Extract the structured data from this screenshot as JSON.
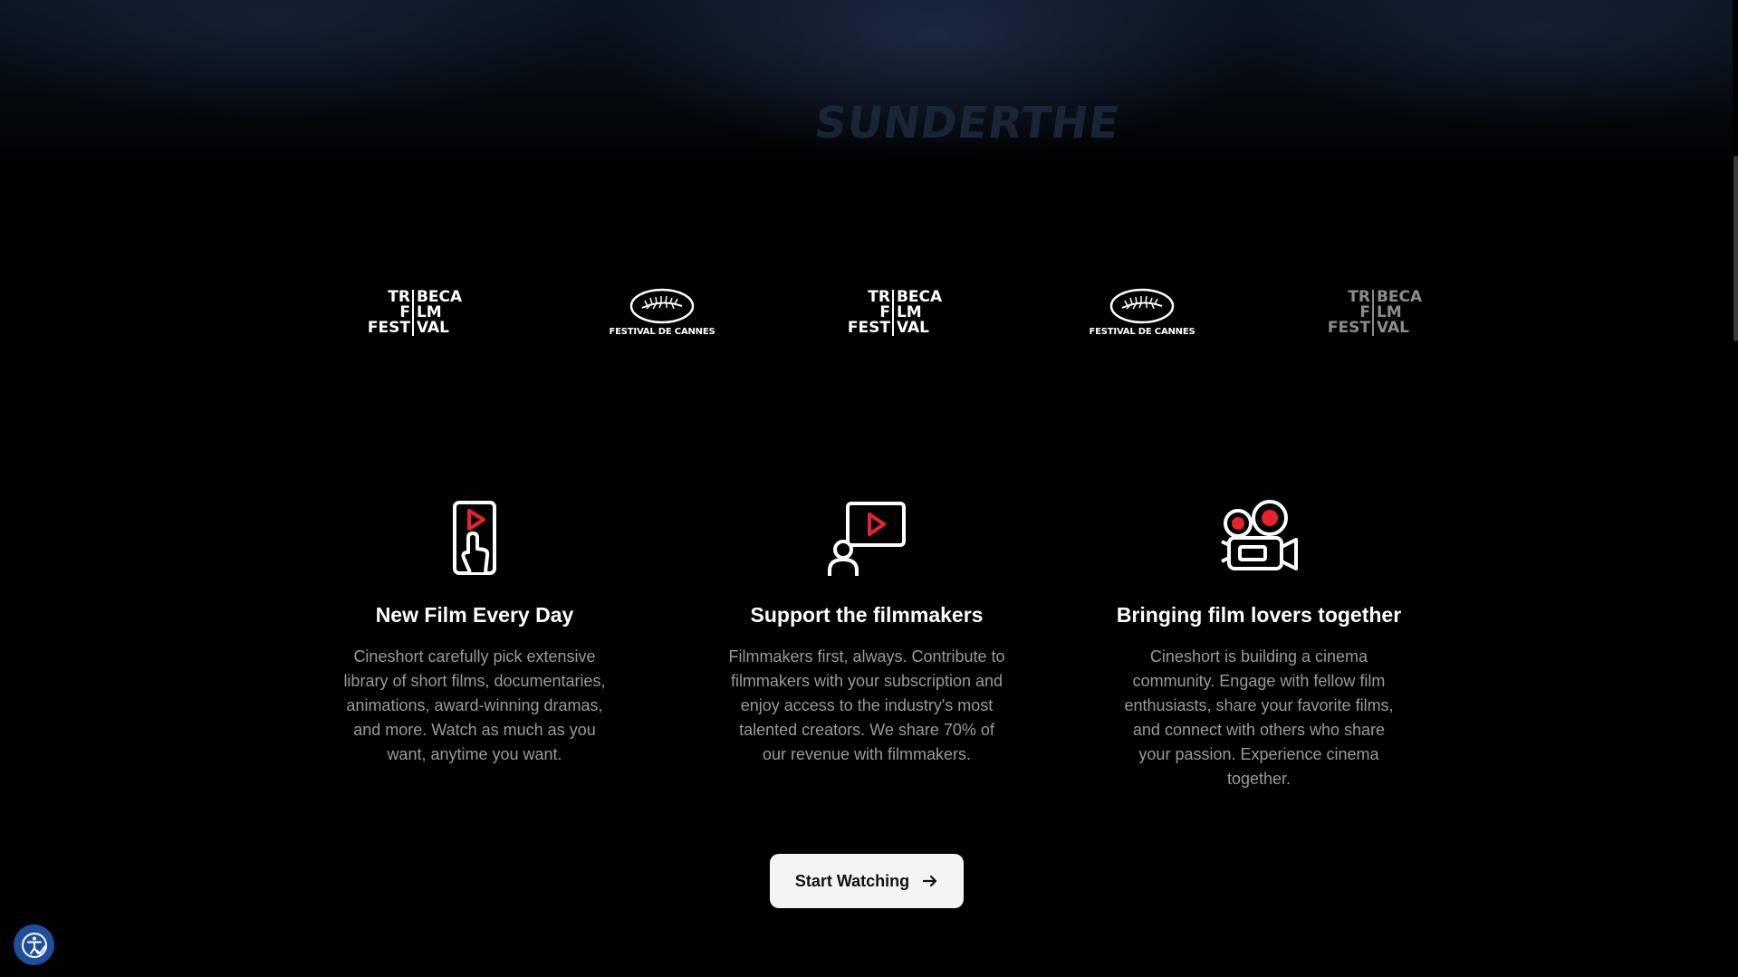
{
  "hero": {
    "overlay_text": "SUNDERTHE"
  },
  "logos": [
    {
      "type": "tribeca",
      "rows": [
        [
          "TR",
          "BECA"
        ],
        [
          "F",
          "LM"
        ],
        [
          "FEST",
          "VAL"
        ]
      ]
    },
    {
      "type": "cannes",
      "caption": "FESTIVAL DE CANNES"
    },
    {
      "type": "tribeca",
      "rows": [
        [
          "TR",
          "BECA"
        ],
        [
          "F",
          "LM"
        ],
        [
          "FEST",
          "VAL"
        ]
      ]
    },
    {
      "type": "cannes",
      "caption": "FESTIVAL DE CANNES"
    },
    {
      "type": "tribeca",
      "rows": [
        [
          "TR",
          "BECA"
        ],
        [
          "F",
          "LM"
        ],
        [
          "FEST",
          "VAL"
        ]
      ]
    }
  ],
  "features": [
    {
      "title": "New Film Every Day",
      "body": "Cineshort carefully pick extensive library of short films, documentaries, animations, award-winning dramas, and more. Watch as much as you want, anytime you want.",
      "icon": "touch-play-icon"
    },
    {
      "title": "Support the filmmakers",
      "body": "Filmmakers first, always. Contribute to filmmakers with your subscription and enjoy access to the industry's most talented creators. We share 70% of our revenue with filmmakers.",
      "icon": "presenter-play-icon"
    },
    {
      "title": "Bringing film lovers together",
      "body": "Cineshort is building a cinema community. Engage with fellow film enthusiasts, share your favorite films, and connect with others who share your passion. Experience cinema together.",
      "icon": "film-camera-icon"
    }
  ],
  "cta": {
    "label": "Start Watching",
    "icon": "arrow-right-icon"
  },
  "accessibility": {
    "icon": "accessibility-icon"
  },
  "colors": {
    "accent": "#e8232b",
    "background": "#000000",
    "button_bg": "#f4f4f4",
    "a11y_bg": "#1e4f9c"
  }
}
